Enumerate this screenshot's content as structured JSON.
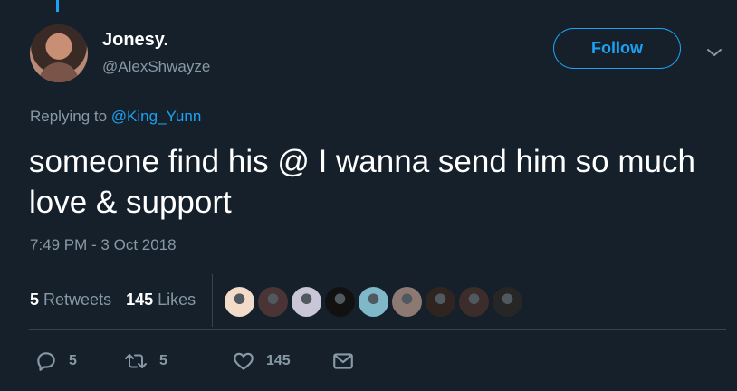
{
  "author": {
    "name": "Jonesy.",
    "handle": "@AlexShwayze"
  },
  "follow_label": "Follow",
  "reply": {
    "prefix": "Replying to ",
    "mention": "@King_Yunn"
  },
  "tweet_text": "someone find his @ I wanna send him so much love & support",
  "timestamp": "7:49 PM - 3 Oct 2018",
  "stats": {
    "retweets_count": "5",
    "retweets_label": "Retweets",
    "likes_count": "145",
    "likes_label": "Likes"
  },
  "liker_avatars": [
    {
      "color": "#f2dcc9"
    },
    {
      "color": "#4b3436"
    },
    {
      "color": "#c9c6d8"
    },
    {
      "color": "#111111"
    },
    {
      "color": "#7fb9c9"
    },
    {
      "color": "#8c7a72"
    },
    {
      "color": "#2f2420"
    },
    {
      "color": "#3c2c2a"
    },
    {
      "color": "#262626"
    }
  ],
  "actions": {
    "reply_count": "5",
    "retweet_count": "5",
    "like_count": "145"
  },
  "colors": {
    "background": "#15202b",
    "accent": "#1da1f2",
    "secondary_text": "#8899a6",
    "divider": "#38444d"
  },
  "icons": [
    "chevron-down-icon",
    "reply-icon",
    "retweet-icon",
    "heart-icon",
    "envelope-icon"
  ]
}
